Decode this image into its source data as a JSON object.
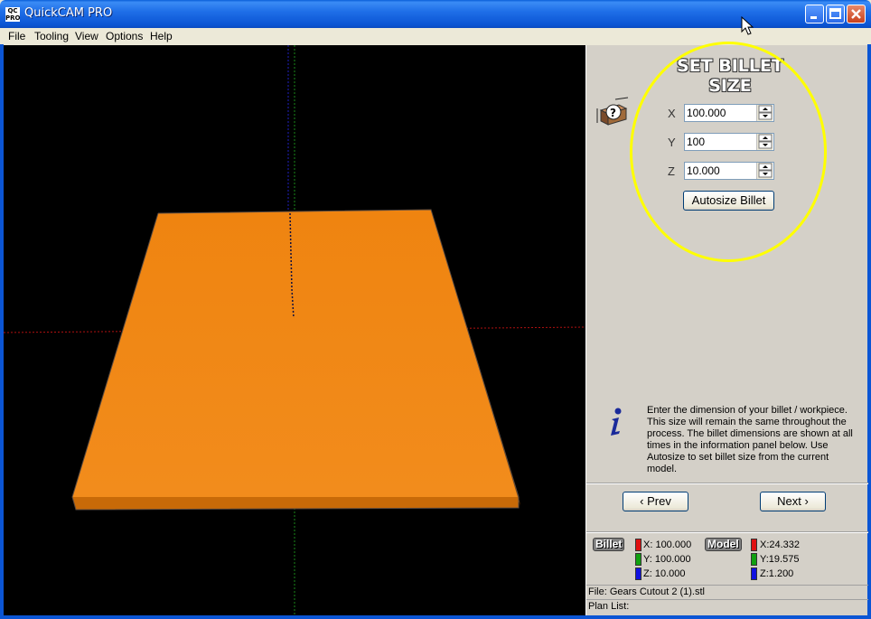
{
  "window": {
    "title": "QuickCAM PRO",
    "icon_text": "QC PRO"
  },
  "menu": [
    "File",
    "Tooling",
    "View",
    "Options",
    "Help"
  ],
  "panel": {
    "title": "SET BILLET SIZE",
    "fields": [
      {
        "label": "X",
        "value": "100.000"
      },
      {
        "label": "Y",
        "value": "100"
      },
      {
        "label": "Z",
        "value": "10.000"
      }
    ],
    "autosize_label": "Autosize Billet",
    "info_text": "Enter the dimension of your billet / workpiece. This size will remain the same throughout the process. The billet dimensions are shown at all times in the information panel below. Use Autosize to set billet size from the current model.",
    "prev_label": "‹ Prev",
    "next_label": "Next ›"
  },
  "stats": {
    "billet_label": "Billet",
    "model_label": "Model",
    "billet": [
      "X: 100.000",
      "Y: 100.000",
      "Z: 10.000"
    ],
    "model": [
      "X:24.332",
      "Y:19.575",
      "Z:1.200"
    ],
    "axis_colors": [
      "#e01010",
      "#10a010",
      "#1010e0"
    ]
  },
  "status": {
    "file": "File: Gears Cutout 2 (1).stl",
    "plan": "Plan List:"
  },
  "colors": {
    "billet": "#f08a10",
    "highlight": "#ffff00",
    "titlebar": "#0b55d4"
  }
}
